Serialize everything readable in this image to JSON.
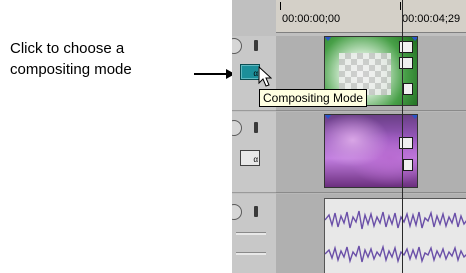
{
  "callout": {
    "line1": "Click to choose a",
    "line2": "compositing mode"
  },
  "ruler": {
    "time_start": "00:00:00;00",
    "time_end": "00:00:04;29"
  },
  "tooltip": {
    "text": "Compositing Mode"
  },
  "tracks": [
    {
      "type": "video",
      "name": "overlay-track"
    },
    {
      "type": "video",
      "name": "background-track"
    },
    {
      "type": "audio",
      "name": "audio-track"
    }
  ],
  "icons": {
    "knob": "pan-knob-icon",
    "bang": "fx-bang-icon",
    "compositing": "compositing-mode-icon",
    "crop": "event-pan-crop-icon",
    "generated": "generated-media-icon"
  },
  "colors": {
    "tooltip_bg": "#ffffe1",
    "compositing_active": "#1c8f9a",
    "waveform": "#6a4fa8"
  }
}
